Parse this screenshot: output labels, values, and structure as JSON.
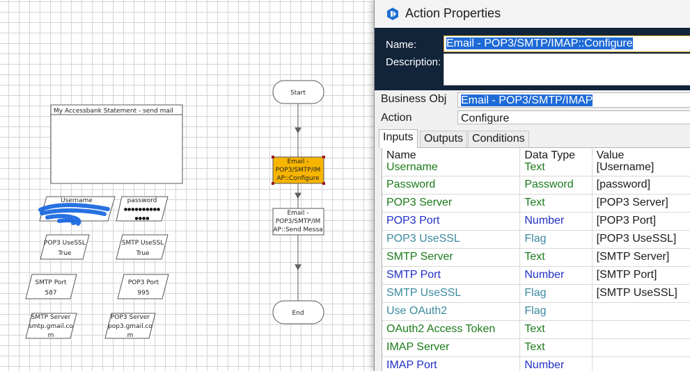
{
  "diagram": {
    "note_title": "My Accessbank Statement - send mail",
    "start_label": "Start",
    "end_label": "End",
    "configure_stage": [
      "Email -",
      "POP3/SMTP/IM",
      "AP::Configure"
    ],
    "send_stage": [
      "Email -",
      "POP3/SMTP/IM",
      "AP::Send Messa"
    ],
    "data_items": [
      {
        "id": "username",
        "lines": [
          "Username"
        ]
      },
      {
        "id": "password",
        "lines": [
          "password",
          "●●●●●●●●●●",
          "●●●●"
        ]
      },
      {
        "id": "pop3-usessl",
        "lines": [
          "POP3 UseSSL",
          "True"
        ]
      },
      {
        "id": "smtp-usessl",
        "lines": [
          "SMTP UseSSL",
          "True"
        ]
      },
      {
        "id": "smtp-port",
        "lines": [
          "SMTP Port",
          "587"
        ]
      },
      {
        "id": "pop3-port",
        "lines": [
          "POP3 Port",
          "995"
        ]
      },
      {
        "id": "smtp-server",
        "lines": [
          "SMTP Server",
          "smtp.gmail.co",
          "m"
        ]
      },
      {
        "id": "pop3-server",
        "lines": [
          "POP3 Server",
          "pop3.gmail.co",
          "m"
        ]
      }
    ]
  },
  "dialog": {
    "title": "Action Properties",
    "name_label": "Name:",
    "name_value": "Email - POP3/SMTP/IMAP::Configure",
    "description_label": "Description:",
    "business_obj_label": "Business Obj",
    "business_obj_value": "Email - POP3/SMTP/IMAP",
    "action_label": "Action",
    "action_value": "Configure",
    "tabs": [
      "Inputs",
      "Outputs",
      "Conditions"
    ],
    "columns": [
      "Name",
      "Data Type",
      "Value"
    ],
    "rows": [
      {
        "name": "Username",
        "type": "Text",
        "value": "[Username]",
        "color": "#1a7a1a"
      },
      {
        "name": "Password",
        "type": "Password",
        "value": "[password]",
        "color": "#1a7a1a"
      },
      {
        "name": "POP3 Server",
        "type": "Text",
        "value": "[POP3 Server]",
        "color": "#1a7a1a"
      },
      {
        "name": "POP3 Port",
        "type": "Number",
        "value": "[POP3 Port]",
        "color": "#1f2fc4"
      },
      {
        "name": "POP3 UseSSL",
        "type": "Flag",
        "value": "[POP3 UseSSL]",
        "color": "#3a8a9e"
      },
      {
        "name": "SMTP Server",
        "type": "Text",
        "value": "[SMTP Server]",
        "color": "#1a7a1a"
      },
      {
        "name": "SMTP Port",
        "type": "Number",
        "value": "[SMTP Port]",
        "color": "#1f2fc4"
      },
      {
        "name": "SMTP UseSSL",
        "type": "Flag",
        "value": "[SMTP UseSSL]",
        "color": "#3a8a9e"
      },
      {
        "name": "Use OAuth2",
        "type": "Flag",
        "value": "",
        "color": "#3a8a9e"
      },
      {
        "name": "OAuth2 Access Token",
        "type": "Text",
        "value": "",
        "color": "#1a7a1a"
      },
      {
        "name": "IMAP Server",
        "type": "Text",
        "value": "",
        "color": "#1a7a1a"
      },
      {
        "name": "IMAP Port",
        "type": "Number",
        "value": "",
        "color": "#1f2fc4"
      }
    ]
  },
  "colors": {
    "stage_selected_fill": "#f7b500",
    "header_band": "#12243a",
    "selection_highlight": "#1e6ad6",
    "scribble": "#1565e0"
  }
}
